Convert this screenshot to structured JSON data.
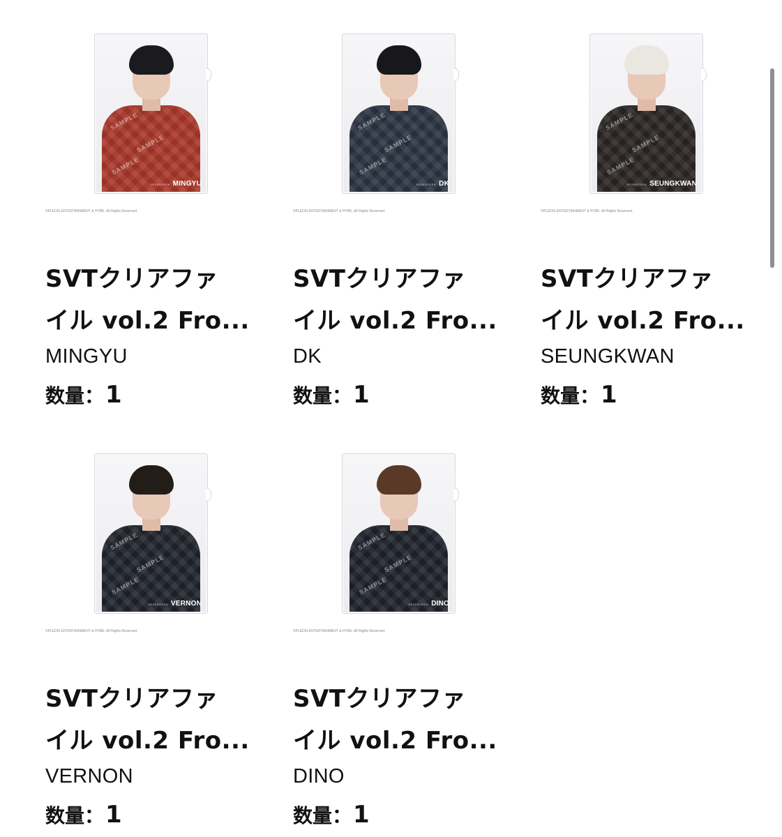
{
  "items": [
    {
      "title_line1": "SVTクリアファ",
      "title_line2": "イル vol.2 Fro...",
      "member": "MINGYU",
      "qty_label": "数量：",
      "qty_value": "1",
      "card_group": "SEVENTEEN",
      "card_name": "MINGYU",
      "copyright": "©PLEDIS ENTERTAINMENT & HYBE. All Rights Reserved.",
      "outfit_color": "#a9372a",
      "hair_color": "#1a1a1f",
      "watermark": "SAMPLE"
    },
    {
      "title_line1": "SVTクリアファ",
      "title_line2": "イル vol.2 Fro...",
      "member": "DK",
      "qty_label": "数量：",
      "qty_value": "1",
      "card_group": "SEVENTEEN",
      "card_name": "DK",
      "copyright": "©PLEDIS ENTERTAINMENT & HYBE. All Rights Reserved.",
      "outfit_color": "#2c3442",
      "hair_color": "#18181c",
      "watermark": "SAMPLE"
    },
    {
      "title_line1": "SVTクリアファ",
      "title_line2": "イル vol.2 Fro...",
      "member": "SEUNGKWAN",
      "qty_label": "数量：",
      "qty_value": "1",
      "card_group": "SEVENTEEN",
      "card_name": "SEUNGKWAN",
      "copyright": "©PLEDIS ENTERTAINMENT & HYBE. All Rights Reserved.",
      "outfit_color": "#2b2624",
      "hair_color": "#e9e7df",
      "watermark": "SAMPLE"
    },
    {
      "title_line1": "SVTクリアファ",
      "title_line2": "イル vol.2 Fro...",
      "member": "VERNON",
      "qty_label": "数量：",
      "qty_value": "1",
      "card_group": "SEVENTEEN",
      "card_name": "VERNON",
      "copyright": "©PLEDIS ENTERTAINMENT & HYBE. All Rights Reserved.",
      "outfit_color": "#20242c",
      "hair_color": "#231d1a",
      "watermark": "SAMPLE"
    },
    {
      "title_line1": "SVTクリアファ",
      "title_line2": "イル vol.2 Fro...",
      "member": "DINO",
      "qty_label": "数量：",
      "qty_value": "1",
      "card_group": "SEVENTEEN",
      "card_name": "DINO",
      "copyright": "©PLEDIS ENTERTAINMENT & HYBE. All Rights Reserved.",
      "outfit_color": "#1f232b",
      "hair_color": "#5a3a26",
      "watermark": "SAMPLE"
    }
  ]
}
